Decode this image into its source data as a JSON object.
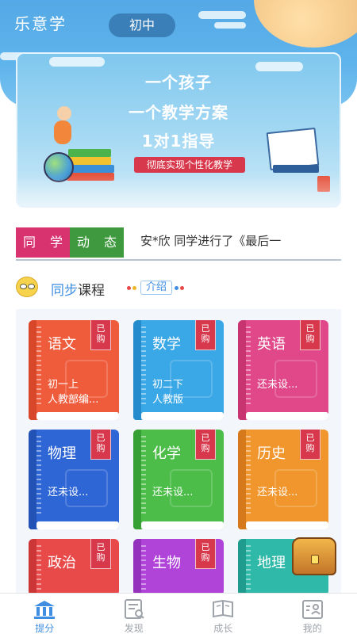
{
  "header": {
    "app_title": "乐意学",
    "grade": "初中"
  },
  "banner": {
    "line1": "一个孩子",
    "line2": "一个教学方案",
    "line3": "1对1指导",
    "tagline": "彻底实现个性化教学"
  },
  "dynamics": {
    "tiles": [
      {
        "char": "同",
        "color": "#d9336f"
      },
      {
        "char": "学",
        "color": "#d9336f"
      },
      {
        "char": "动",
        "color": "#3f9a3f"
      },
      {
        "char": "态",
        "color": "#3f9a3f"
      }
    ],
    "ticker": "安*欣 同学进行了《最后一"
  },
  "section": {
    "title_highlight": "同步",
    "title_rest": "课程",
    "intro_label": "介绍"
  },
  "courses": [
    {
      "subject": "语文",
      "line1": "初一上",
      "line2": "人教部编...",
      "tag": "已购",
      "color": "#ef5c3c",
      "spine": "#d8472a"
    },
    {
      "subject": "数学",
      "line1": "初二下",
      "line2": "人教版",
      "tag": "已购",
      "color": "#3aa7e6",
      "spine": "#248ccc"
    },
    {
      "subject": "英语",
      "line1": "还未设...",
      "line2": "",
      "tag": "已购",
      "color": "#e04889",
      "spine": "#c73470"
    },
    {
      "subject": "物理",
      "line1": "还未设...",
      "line2": "",
      "tag": "已购",
      "color": "#2f66d6",
      "spine": "#2352b6"
    },
    {
      "subject": "化学",
      "line1": "还未设...",
      "line2": "",
      "tag": "已购",
      "color": "#4cbd48",
      "spine": "#37a035"
    },
    {
      "subject": "历史",
      "line1": "还未设...",
      "line2": "",
      "tag": "已购",
      "color": "#f0962c",
      "spine": "#d6791a"
    },
    {
      "subject": "政治",
      "line1": "",
      "line2": "",
      "tag": "已购",
      "color": "#e84a4a",
      "spine": "#cc3636"
    },
    {
      "subject": "生物",
      "line1": "",
      "line2": "",
      "tag": "已购",
      "color": "#b044d8",
      "spine": "#9532bd"
    },
    {
      "subject": "地理",
      "line1": "",
      "line2": "",
      "tag": "已购",
      "color": "#2fb9a8",
      "spine": "#1f9c8d"
    }
  ],
  "nav": {
    "items": [
      {
        "label": "提分",
        "icon": "bank-icon",
        "active": true
      },
      {
        "label": "发现",
        "icon": "discover-icon",
        "active": false
      },
      {
        "label": "成长",
        "icon": "growth-book-icon",
        "active": false
      },
      {
        "label": "我的",
        "icon": "profile-card-icon",
        "active": false
      }
    ]
  },
  "colors": {
    "accent": "#3f8ee2",
    "header_blue": "#5fb4ec",
    "tag_red": "#d8384c"
  }
}
